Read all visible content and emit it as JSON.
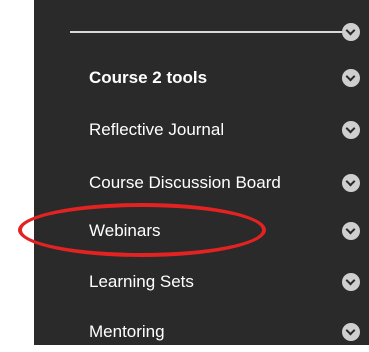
{
  "menu": {
    "items": [
      {
        "label": "Course 2 tools",
        "bold": true
      },
      {
        "label": "Reflective Journal"
      },
      {
        "label": "Course Discussion Board"
      },
      {
        "label": "Webinars"
      },
      {
        "label": "Learning Sets"
      },
      {
        "label": "Mentoring"
      }
    ]
  },
  "icons": {
    "expand": "chevron-down-icon"
  },
  "colors": {
    "panel_bg": "#2a2a2a",
    "text": "#ffffff",
    "chevron_bg": "#cfcfcf",
    "highlight_circle": "#e32222"
  }
}
